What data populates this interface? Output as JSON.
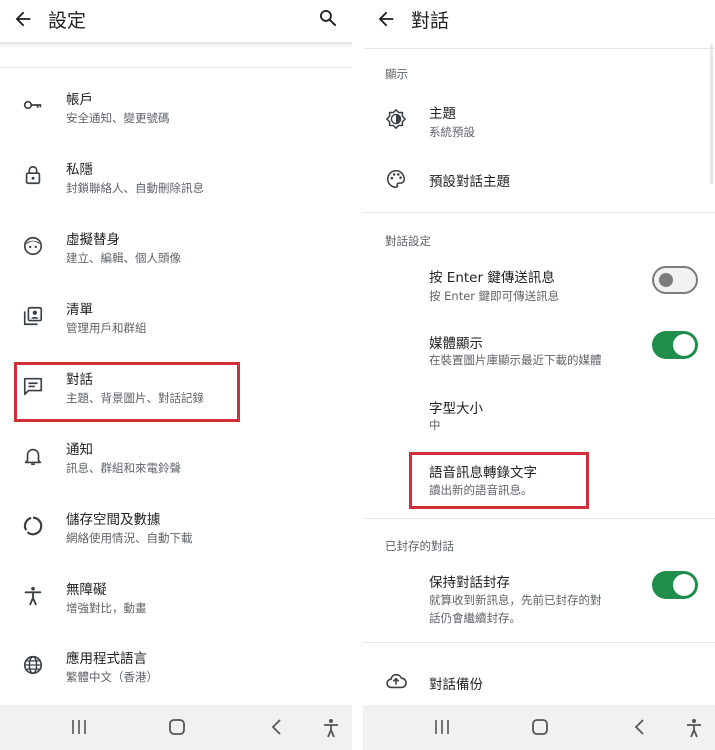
{
  "left": {
    "title": "設定",
    "items": [
      {
        "title": "帳戶",
        "subtitle": "安全通知、變更號碼",
        "icon": "key-icon"
      },
      {
        "title": "私隱",
        "subtitle": "封鎖聯絡人、自動刪除訊息",
        "icon": "lock-icon"
      },
      {
        "title": "虛擬替身",
        "subtitle": "建立、編輯、個人頭像",
        "icon": "avatar-icon"
      },
      {
        "title": "清單",
        "subtitle": "管理用戶和群組",
        "icon": "contacts-list-icon"
      },
      {
        "title": "對話",
        "subtitle": "主題、背景圖片、對話記錄",
        "icon": "chat-icon"
      },
      {
        "title": "通知",
        "subtitle": "訊息、群組和來電鈴聲",
        "icon": "bell-icon"
      },
      {
        "title": "儲存空間及數據",
        "subtitle": "網絡使用情況、自動下載",
        "icon": "storage-icon"
      },
      {
        "title": "無障礙",
        "subtitle": "增強對比，動畫",
        "icon": "accessibility-icon"
      },
      {
        "title": "應用程式語言",
        "subtitle": "繁體中文（香港）",
        "icon": "globe-icon"
      }
    ]
  },
  "right": {
    "title": "對話",
    "sections": {
      "display": "顯示",
      "chat_settings": "對話設定",
      "archived": "已封存的對話"
    },
    "theme": {
      "title": "主題",
      "subtitle": "系統預設"
    },
    "default_theme": {
      "title": "預設對話主題"
    },
    "enter_send": {
      "title": "按 Enter 鍵傳送訊息",
      "subtitle": "按 Enter 鍵即可傳送訊息",
      "enabled": false
    },
    "media_visibility": {
      "title": "媒體顯示",
      "subtitle": "在裝置圖片庫顯示最近下載的媒體",
      "enabled": true
    },
    "font_size": {
      "title": "字型大小",
      "subtitle": "中"
    },
    "voice_transcripts": {
      "title": "語音訊息轉錄文字",
      "subtitle": "讀出新的語音訊息。"
    },
    "keep_archived": {
      "title": "保持對話封存",
      "subtitle_line1": "就算收到新訊息，先前已封存的對",
      "subtitle_line2": "話仍會繼續封存。",
      "enabled": true
    },
    "backup": {
      "title": "對話備份"
    }
  },
  "colors": {
    "highlight": "#d32f3a",
    "toggle_on": "#1e8e4a",
    "toggle_off": "#7b7b7b"
  }
}
